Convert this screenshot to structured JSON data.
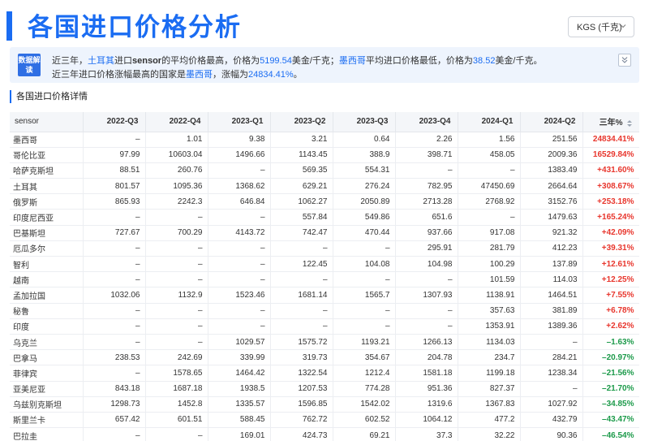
{
  "page": {
    "title": "各国进口价格分析",
    "currency_select": "KGS (千克)"
  },
  "insight": {
    "badge": "数据解读",
    "line1": {
      "p1": "近三年，",
      "country": "土耳其",
      "p2": "进口",
      "product": "sensor",
      "p3": "的平均价格最高，价格为",
      "price": "5199.54",
      "p4": "美金/千克；",
      "low_country": "墨西哥",
      "p5": "平均进口价格最低，价格为",
      "low_price": "38.52",
      "p6": "美金/千克。"
    },
    "line2": {
      "p1": "近三年进口价格涨幅最高的国家是",
      "country": "墨西哥",
      "p2": "，涨幅为",
      "pct": "24834.41%",
      "p3": "。"
    }
  },
  "section": {
    "title": "各国进口价格详情"
  },
  "table": {
    "headers": [
      "sensor",
      "2022-Q3",
      "2022-Q4",
      "2023-Q1",
      "2023-Q2",
      "2023-Q3",
      "2023-Q4",
      "2024-Q1",
      "2024-Q2",
      "三年%"
    ],
    "rows": [
      {
        "name": "墨西哥",
        "values": [
          "–",
          "1.01",
          "9.38",
          "3.21",
          "0.64",
          "2.26",
          "1.56",
          "251.56"
        ],
        "pct": "24834.41%",
        "dir": "up"
      },
      {
        "name": "哥伦比亚",
        "values": [
          "97.99",
          "10603.04",
          "1496.66",
          "1143.45",
          "388.9",
          "398.71",
          "458.05",
          "2009.36"
        ],
        "pct": "16529.84%",
        "dir": "up"
      },
      {
        "name": "哈萨克斯坦",
        "values": [
          "88.51",
          "260.76",
          "–",
          "569.35",
          "554.31",
          "–",
          "–",
          "1383.49"
        ],
        "pct": "+431.60%",
        "dir": "up"
      },
      {
        "name": "土耳其",
        "values": [
          "801.57",
          "1095.36",
          "1368.62",
          "629.21",
          "276.24",
          "782.95",
          "47450.69",
          "2664.64"
        ],
        "pct": "+308.67%",
        "dir": "up"
      },
      {
        "name": "俄罗斯",
        "values": [
          "865.93",
          "2242.3",
          "646.84",
          "1062.27",
          "2050.89",
          "2713.28",
          "2768.92",
          "3152.76"
        ],
        "pct": "+253.18%",
        "dir": "up"
      },
      {
        "name": "印度尼西亚",
        "values": [
          "–",
          "–",
          "–",
          "557.84",
          "549.86",
          "651.6",
          "–",
          "1479.63"
        ],
        "pct": "+165.24%",
        "dir": "up"
      },
      {
        "name": "巴基斯坦",
        "values": [
          "727.67",
          "700.29",
          "4143.72",
          "742.47",
          "470.44",
          "937.66",
          "917.08",
          "921.32"
        ],
        "pct": "+42.09%",
        "dir": "up"
      },
      {
        "name": "厄瓜多尔",
        "values": [
          "–",
          "–",
          "–",
          "–",
          "–",
          "295.91",
          "281.79",
          "412.23"
        ],
        "pct": "+39.31%",
        "dir": "up"
      },
      {
        "name": "智利",
        "values": [
          "–",
          "–",
          "–",
          "122.45",
          "104.08",
          "104.98",
          "100.29",
          "137.89"
        ],
        "pct": "+12.61%",
        "dir": "up"
      },
      {
        "name": "越南",
        "values": [
          "–",
          "–",
          "–",
          "–",
          "–",
          "–",
          "101.59",
          "114.03"
        ],
        "pct": "+12.25%",
        "dir": "up"
      },
      {
        "name": "孟加拉国",
        "values": [
          "1032.06",
          "1132.9",
          "1523.46",
          "1681.14",
          "1565.7",
          "1307.93",
          "1138.91",
          "1464.51"
        ],
        "pct": "+7.55%",
        "dir": "up"
      },
      {
        "name": "秘鲁",
        "values": [
          "–",
          "–",
          "–",
          "–",
          "–",
          "–",
          "357.63",
          "381.89"
        ],
        "pct": "+6.78%",
        "dir": "up"
      },
      {
        "name": "印度",
        "values": [
          "–",
          "–",
          "–",
          "–",
          "–",
          "–",
          "1353.91",
          "1389.36"
        ],
        "pct": "+2.62%",
        "dir": "up"
      },
      {
        "name": "乌克兰",
        "values": [
          "–",
          "–",
          "1029.57",
          "1575.72",
          "1193.21",
          "1266.13",
          "1134.03",
          "–"
        ],
        "pct": "–1.63%",
        "dir": "down"
      },
      {
        "name": "巴拿马",
        "values": [
          "238.53",
          "242.69",
          "339.99",
          "319.73",
          "354.67",
          "204.78",
          "234.7",
          "284.21"
        ],
        "pct": "–20.97%",
        "dir": "down"
      },
      {
        "name": "菲律宾",
        "values": [
          "–",
          "1578.65",
          "1464.42",
          "1322.54",
          "1212.4",
          "1581.18",
          "1199.18",
          "1238.34"
        ],
        "pct": "–21.56%",
        "dir": "down"
      },
      {
        "name": "亚美尼亚",
        "values": [
          "843.18",
          "1687.18",
          "1938.5",
          "1207.53",
          "774.28",
          "951.36",
          "827.37",
          "–"
        ],
        "pct": "–21.70%",
        "dir": "down"
      },
      {
        "name": "乌兹别克斯坦",
        "values": [
          "1298.73",
          "1452.8",
          "1335.57",
          "1596.85",
          "1542.02",
          "1319.6",
          "1367.83",
          "1027.92"
        ],
        "pct": "–34.85%",
        "dir": "down"
      },
      {
        "name": "斯里兰卡",
        "values": [
          "657.42",
          "601.51",
          "588.45",
          "762.72",
          "602.52",
          "1064.12",
          "477.2",
          "432.79"
        ],
        "pct": "–43.47%",
        "dir": "down"
      },
      {
        "name": "巴拉圭",
        "values": [
          "–",
          "–",
          "169.01",
          "424.73",
          "69.21",
          "37.3",
          "32.22",
          "90.36"
        ],
        "pct": "–46.54%",
        "dir": "down"
      }
    ]
  },
  "colors": {
    "accent": "#1a6cf2",
    "up": "#e8362d",
    "down": "#1c9a4a",
    "insight_bg": "#eef4fd"
  },
  "icons": {
    "select_chevron": "chevron-down-icon",
    "collapse": "double-chevron-down-icon",
    "sort": "sort-icon",
    "row_trend": "trend-chart-icon"
  }
}
